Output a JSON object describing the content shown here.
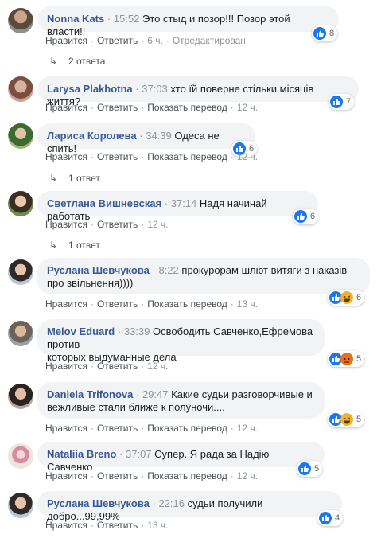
{
  "comments": [
    {
      "author": "Nonna Kats",
      "time": "15:52",
      "text": "Это стыд и позор!!! Позор этой власти!!",
      "reactions": "8",
      "like": "Нравится",
      "reply": "Ответить",
      "age": "6 ч.",
      "edited": "Отредактирован"
    },
    {
      "author": "Larysa Plakhotna",
      "time": "37:03",
      "text": "хто їй поверне стільки місяців життя?",
      "reactions": "7",
      "like": "Нравится",
      "reply": "Ответить",
      "translate": "Показать перевод",
      "age": "12 ч."
    },
    {
      "author": "Лариса Королева",
      "time": "34:39",
      "text": "Одеса не спить!",
      "reactions": "6",
      "like": "Нравится",
      "reply": "Ответить",
      "translate": "Показать перевод",
      "age": "12 ч."
    },
    {
      "author": "Светлана Вишневская",
      "time": "37:14",
      "text": "Надя начинай работать",
      "reactions": "6",
      "like": "Нравится",
      "reply": "Ответить",
      "age": "12 ч."
    },
    {
      "author": "Руслана Шевчукова",
      "time": "8:22",
      "text1": "прокурорам шлют витяги з наказів",
      "text2": "про звільнення))))",
      "reactions": "6",
      "like": "Нравится",
      "reply": "Ответить",
      "translate": "Показать перевод",
      "age": "13 ч."
    },
    {
      "author": "Melov Eduard",
      "time": "33:39",
      "text1": "Освободить Савченко,Ефремова против",
      "text2": "которых выдуманные дела",
      "reactions": "5",
      "like": "Нравится",
      "reply": "Ответить",
      "age": "12 ч."
    },
    {
      "author": "Daniela Trifonova",
      "time": "29:47",
      "text1": "Какие судьи разговорчивые и",
      "text2": "вежливые стали ближе к полуночи....",
      "reactions": "5",
      "like": "Нравится",
      "reply": "Ответить",
      "translate": "Показать перевод",
      "age": "12 ч."
    },
    {
      "author": "Nataliia Breno",
      "time": "37:07",
      "text": "Супер. Я рада за Надію Савченко",
      "reactions": "5",
      "like": "Нравится",
      "reply": "Ответить",
      "translate": "Показать перевод",
      "age": "12 ч."
    },
    {
      "author": "Руслана Шевчукова",
      "time": "22:16",
      "text": "судьи получили добро...99,99%",
      "reactions": "4",
      "like": "Нравится",
      "reply": "Ответить",
      "age": "13 ч."
    }
  ],
  "replies": {
    "r1": "2 ответа",
    "r2": "1 ответ",
    "r3": "1 ответ"
  },
  "colors": {
    "link": "#385898",
    "like": "#1877f2",
    "haha": "#f7b125",
    "angry": "#e9710f"
  }
}
